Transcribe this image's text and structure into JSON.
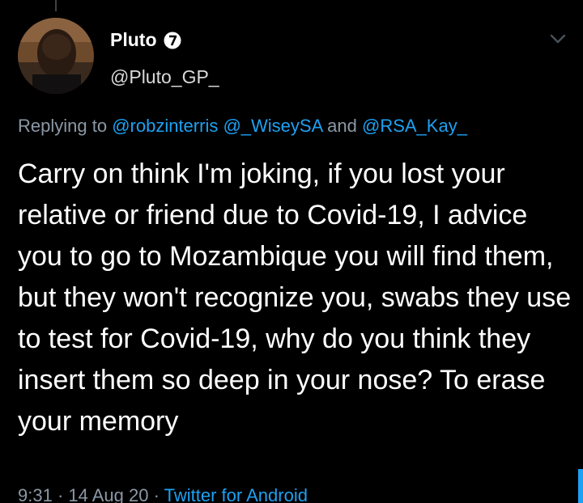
{
  "tweet": {
    "display_name": "Pluto",
    "handle": "@Pluto_GP_",
    "replying_prefix": "Replying to ",
    "reply_mentions": [
      "@robzinterris",
      "@_WiseySA",
      "@RSA_Kay_"
    ],
    "reply_separator": " ",
    "reply_and": " and ",
    "text": "Carry on think I'm joking, if you lost your relative or friend due to Covid-19, I advice you to go to Mozambique you will find them, but they won't recognize you, swabs they use to test for Covid-19, why do you think they insert them so deep in your nose? To erase your memory",
    "time": "9:31",
    "date": "14 Aug 20",
    "meta_sep": " · ",
    "source": "Twitter for Android"
  },
  "icons": {
    "badge": "numeric-badge-icon",
    "caret": "chevron-down-icon"
  },
  "colors": {
    "background": "#000000",
    "accent": "#1da1f2",
    "muted": "#8b98a5"
  }
}
